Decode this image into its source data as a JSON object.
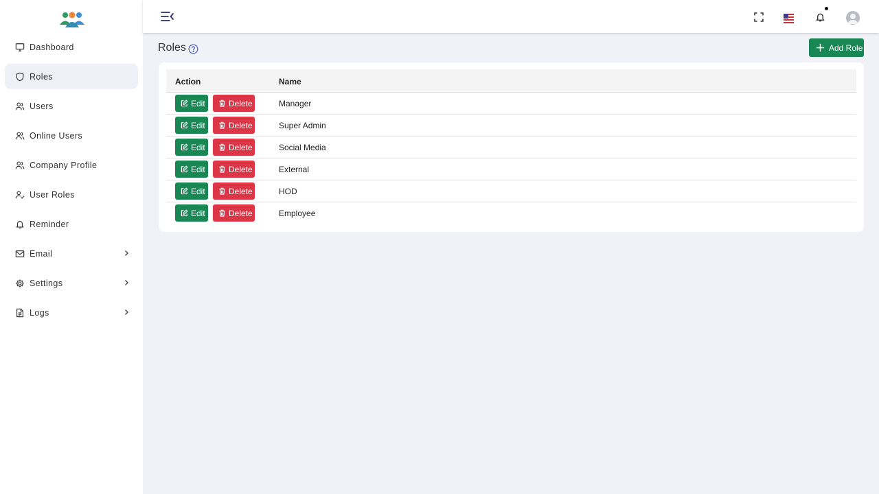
{
  "sidebar": {
    "items": [
      {
        "label": "Dashboard",
        "icon": "monitor-icon",
        "active": false,
        "expandable": false
      },
      {
        "label": "Roles",
        "icon": "shield-icon",
        "active": true,
        "expandable": false
      },
      {
        "label": "Users",
        "icon": "users-icon",
        "active": false,
        "expandable": false
      },
      {
        "label": "Online Users",
        "icon": "users-icon",
        "active": false,
        "expandable": false
      },
      {
        "label": "Company Profile",
        "icon": "users-icon",
        "active": false,
        "expandable": false
      },
      {
        "label": "User Roles",
        "icon": "user-check-icon",
        "active": false,
        "expandable": false
      },
      {
        "label": "Reminder",
        "icon": "bell-icon",
        "active": false,
        "expandable": false
      },
      {
        "label": "Email",
        "icon": "mail-icon",
        "active": false,
        "expandable": true
      },
      {
        "label": "Settings",
        "icon": "gear-icon",
        "active": false,
        "expandable": true
      },
      {
        "label": "Logs",
        "icon": "document-icon",
        "active": false,
        "expandable": true
      }
    ]
  },
  "page": {
    "title": "Roles",
    "add_button_label": "Add Role"
  },
  "table": {
    "columns": [
      "Action",
      "Name"
    ],
    "edit_label": "Edit",
    "delete_label": "Delete",
    "rows": [
      {
        "name": "Manager"
      },
      {
        "name": "Super Admin"
      },
      {
        "name": "Social Media"
      },
      {
        "name": "External"
      },
      {
        "name": "HOD"
      },
      {
        "name": "Employee"
      }
    ]
  },
  "colors": {
    "primary": "#198754",
    "danger": "#dc3545",
    "active_nav": "#eef0f8",
    "background": "#f1f2f7"
  }
}
